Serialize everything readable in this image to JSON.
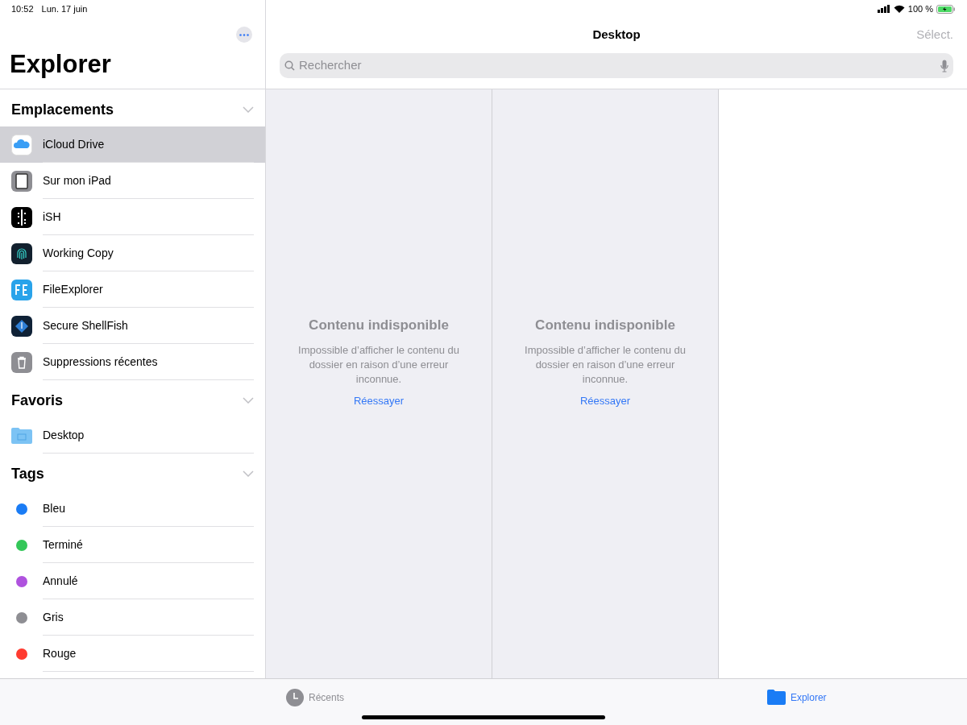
{
  "status_bar": {
    "time": "10:52",
    "date": "Lun. 17 juin",
    "battery": "100 %"
  },
  "sidebar": {
    "title": "Explorer",
    "sections": [
      {
        "title": "Emplacements",
        "expanded": true,
        "items": [
          {
            "label": "iCloud Drive",
            "kind": "cloud",
            "selected": true
          },
          {
            "label": "Sur mon iPad",
            "kind": "ipad",
            "selected": false
          },
          {
            "label": "iSH",
            "kind": "terminal",
            "selected": false
          },
          {
            "label": "Working Copy",
            "kind": "fingerprint",
            "selected": false
          },
          {
            "label": "FileExplorer",
            "kind": "fe",
            "selected": false
          },
          {
            "label": "Secure ShellFish",
            "kind": "shell",
            "selected": false
          },
          {
            "label": "Suppressions récentes",
            "kind": "trash",
            "selected": false
          }
        ]
      },
      {
        "title": "Favoris",
        "expanded": true,
        "items": [
          {
            "label": "Desktop",
            "kind": "folder",
            "selected": false
          }
        ]
      },
      {
        "title": "Tags",
        "expanded": true,
        "items": [
          {
            "label": "Bleu",
            "kind": "tag",
            "color": "#1a7cf5",
            "selected": false
          },
          {
            "label": "Terminé",
            "kind": "tag",
            "color": "#34c759",
            "selected": false
          },
          {
            "label": "Annulé",
            "kind": "tag",
            "color": "#af52de",
            "selected": false
          },
          {
            "label": "Gris",
            "kind": "tag",
            "color": "#8e8e93",
            "selected": false
          },
          {
            "label": "Rouge",
            "kind": "tag",
            "color": "#ff3b30",
            "selected": false
          }
        ]
      }
    ]
  },
  "main": {
    "title": "Desktop",
    "select_button": "Sélect.",
    "search": {
      "placeholder": "Rechercher"
    },
    "columns": [
      {
        "heading": "Contenu indisponible",
        "message": "Impossible d’afficher le contenu du dossier en raison d’une erreur inconnue.",
        "retry": "Réessayer"
      },
      {
        "heading": "Contenu indisponible",
        "message": "Impossible d’afficher le contenu du dossier en raison d’une erreur inconnue.",
        "retry": "Réessayer"
      }
    ]
  },
  "tab_bar": [
    {
      "label": "Récents",
      "kind": "clock",
      "selected": false
    },
    {
      "label": "Explorer",
      "kind": "folder",
      "selected": true
    }
  ]
}
